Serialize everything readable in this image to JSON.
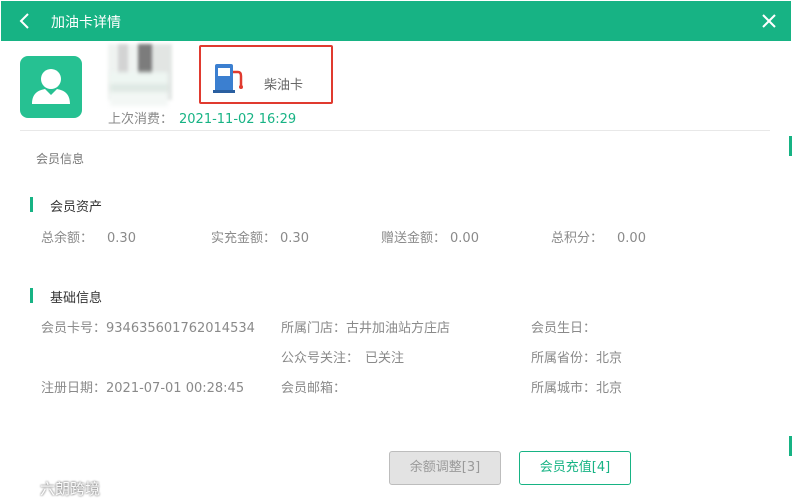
{
  "header": {
    "title": "加油卡详情"
  },
  "member": {
    "card_type": "柴油卡",
    "last_consume_label": "上次消费：",
    "last_consume_time": "2021-11-02 16:29"
  },
  "section_member_info": "会员信息",
  "assets": {
    "heading": "会员资产",
    "fields": [
      {
        "label": "总余额：",
        "value": "0.30"
      },
      {
        "label": "实充金额：",
        "value": "0.30"
      },
      {
        "label": "赠送金额：",
        "value": "0.00"
      },
      {
        "label": "总积分：",
        "value": "0.00"
      }
    ]
  },
  "basic": {
    "heading": "基础信息",
    "card_no": {
      "label": "会员卡号：",
      "value": "934635601762014534"
    },
    "store": {
      "label": "所属门店：",
      "value": "古井加油站方庄店"
    },
    "birthday": {
      "label": "会员生日：",
      "value": ""
    },
    "wechat": {
      "label": "公众号关注：",
      "value": "已关注"
    },
    "province": {
      "label": "所属省份：",
      "value": "北京"
    },
    "register": {
      "label": "注册日期：",
      "value": "2021-07-01 00:28:45"
    },
    "email": {
      "label": "会员邮箱：",
      "value": ""
    },
    "city": {
      "label": "所属城市：",
      "value": "北京"
    }
  },
  "buttons": {
    "adjust": "余额调整[3]",
    "recharge": "会员充值[4]"
  },
  "watermark": {
    "text": "六朗跨境"
  },
  "colors": {
    "accent": "#17b384",
    "highlight_border": "#e03a2f"
  },
  "icons": [
    "back-icon",
    "close-icon",
    "avatar-icon",
    "fuel-pump-icon"
  ]
}
